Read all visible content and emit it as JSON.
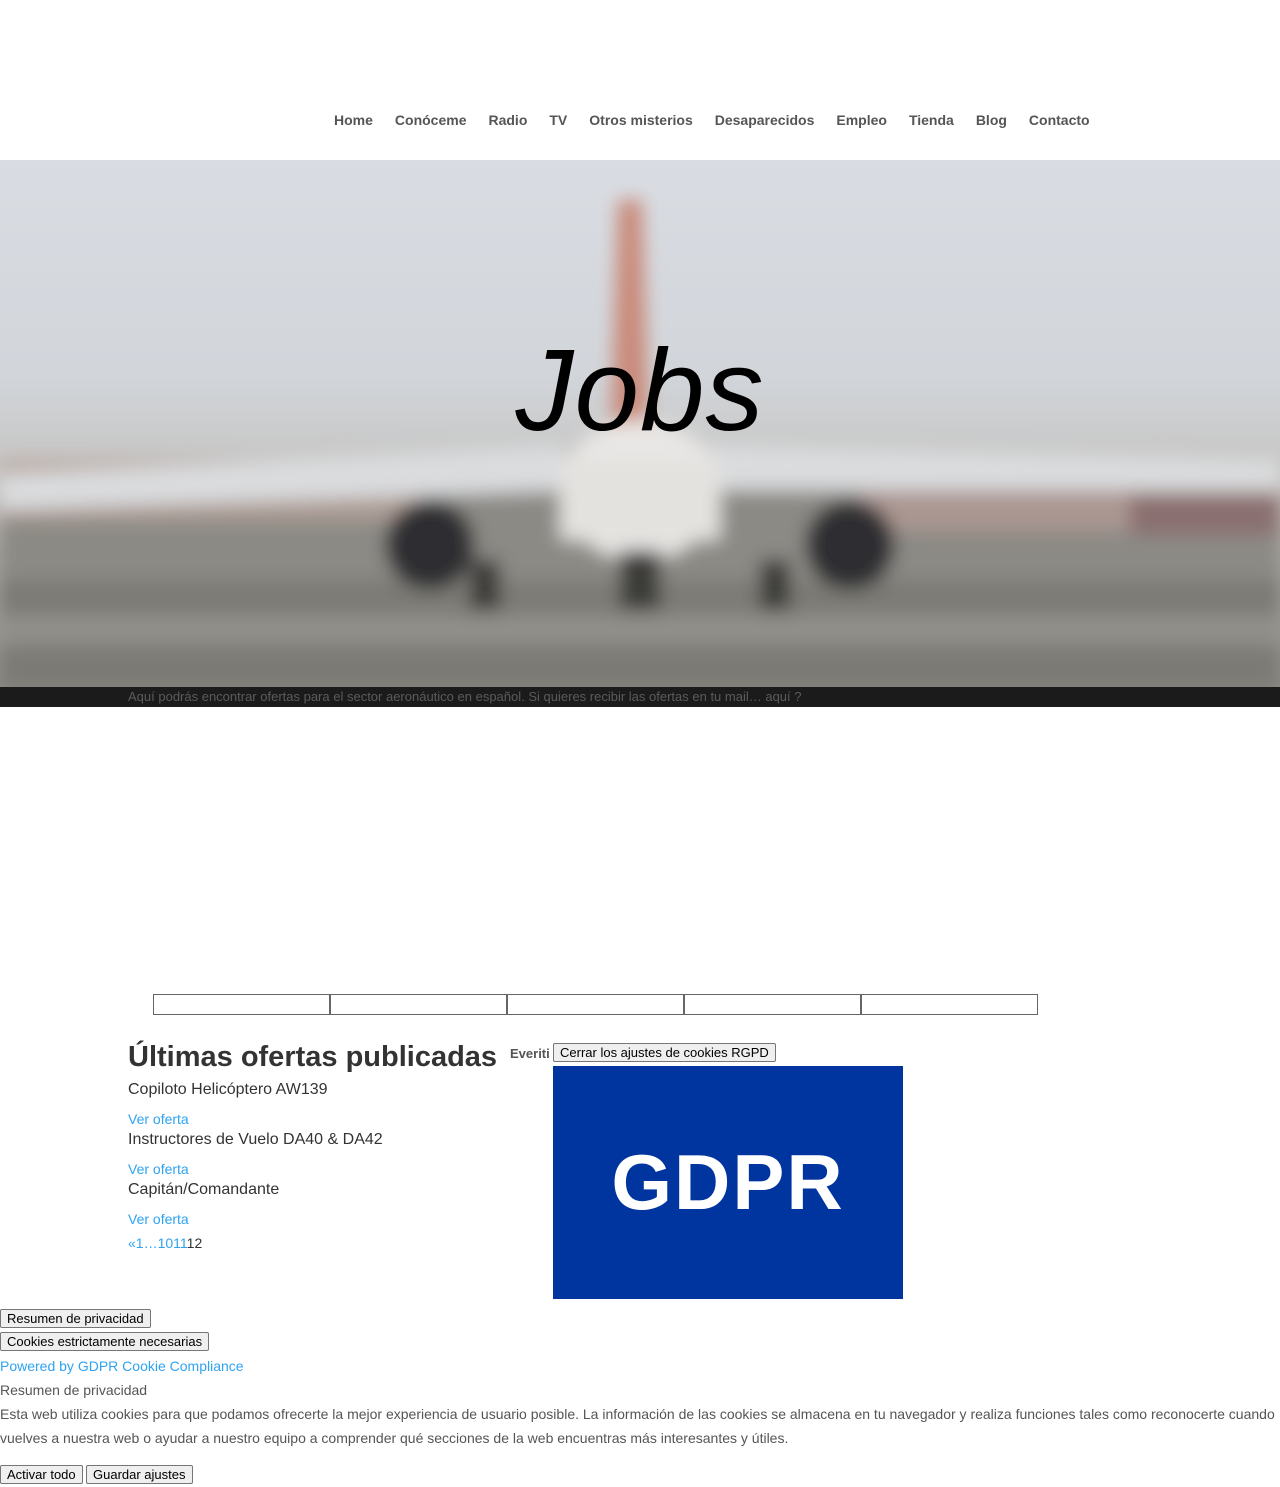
{
  "nav": {
    "items": [
      "Home",
      "Conóceme",
      "Radio",
      "TV",
      "Otros misterios",
      "Desaparecidos",
      "Empleo",
      "Tienda",
      "Blog",
      "Contacto"
    ]
  },
  "hero": {
    "title": "Jobs",
    "strip_text": "Aquí podrás encontrar ofertas para el sector aeronáutico en español. Si quieres recibir las ofertas en tu mail… ",
    "strip_link": "aquí ?"
  },
  "offers": {
    "heading": "Últimas ofertas publicadas",
    "items": [
      {
        "title": "Copiloto Helicóptero AW139",
        "link": "Ver oferta"
      },
      {
        "title": "Instructores de Vuelo DA40 & DA42",
        "link": "Ver oferta"
      },
      {
        "title": "Capitán/Comandante",
        "link": "Ver oferta"
      }
    ],
    "pager": {
      "prev": "«",
      "p1": "1",
      "dots": "…",
      "p10": "10",
      "p11": "11",
      "current": "12"
    }
  },
  "cookie": {
    "everiti": "Everiti",
    "close_button": "Cerrar los ajustes de cookies RGPD",
    "logo_text": "GDPR",
    "tab_summary": "Resumen de privacidad",
    "tab_necessary": "Cookies estrictamente necesarias",
    "powered_prefix": "Powered by ",
    "powered_link": "GDPR Cookie Compliance",
    "summary_heading": "Resumen de privacidad",
    "summary_text": "Esta web utiliza cookies para que podamos ofrecerte la mejor experiencia de usuario posible. La información de las cookies se almacena en tu navegador y realiza funciones tales como reconocerte cuando vuelves a nuestra web o ayudar a nuestro equipo a comprender qué secciones de la web encuentras más interesantes y útiles.",
    "activate_all": "Activar todo",
    "save_settings": "Guardar ajustes"
  },
  "colors": {
    "accent": "#2ea3f2",
    "gdpr_blue": "#00359f",
    "strip": "#1b1b1b"
  }
}
